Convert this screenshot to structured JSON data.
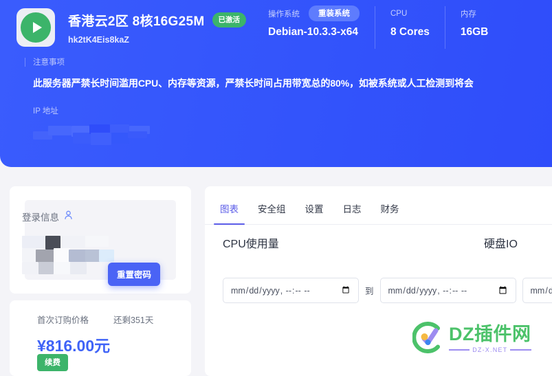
{
  "banner": {
    "server_name": "香港云2区 8核16G25M",
    "status_badge": "已激活",
    "server_id": "hk2tK4Eis8kaZ",
    "play_icon": "play-icon",
    "specs": [
      {
        "label": "操作系统",
        "value": "Debian-10.3.3-x64",
        "action_badge": "重装系统"
      },
      {
        "label": "CPU",
        "value": "8 Cores"
      },
      {
        "label": "内存",
        "value": "16GB"
      }
    ],
    "notice": {
      "label": "注意事项",
      "text": "此服务器严禁长时间滥用CPU、内存等资源，严禁长时间占用带宽总的80%，如被系统或人工检测到将会"
    },
    "ip": {
      "label": "IP 地址",
      "value": ""
    }
  },
  "login_card": {
    "title": "登录信息",
    "user_icon": "person-icon",
    "reset_password_button": "重置密码"
  },
  "price_card": {
    "price_label": "首次订购价格",
    "remaining_label": "还剩351天",
    "amount": "¥816.00元",
    "renew_button": "续费"
  },
  "right_panel": {
    "tabs": [
      {
        "label": "图表",
        "active": true
      },
      {
        "label": "安全组",
        "active": false
      },
      {
        "label": "设置",
        "active": false
      },
      {
        "label": "日志",
        "active": false
      },
      {
        "label": "财务",
        "active": false
      }
    ],
    "charts": [
      {
        "title": "CPU使用量"
      },
      {
        "title": "硬盘IO"
      }
    ],
    "date_range": {
      "start_placeholder": "年 /月/日 ----:--",
      "separator": "到",
      "end_placeholder": "年 /月/日 ----:--",
      "third_placeholder": "年 /月/日 ----:--"
    }
  },
  "watermark": {
    "main": "DZ插件网",
    "sub": "DZ-X.NET"
  },
  "colors": {
    "banner_blue": "#3354fb",
    "accent_indigo": "#5b5ce8",
    "green": "#3cb46a",
    "price_blue": "#3f63f7",
    "page_bg": "#f4f4f8"
  }
}
